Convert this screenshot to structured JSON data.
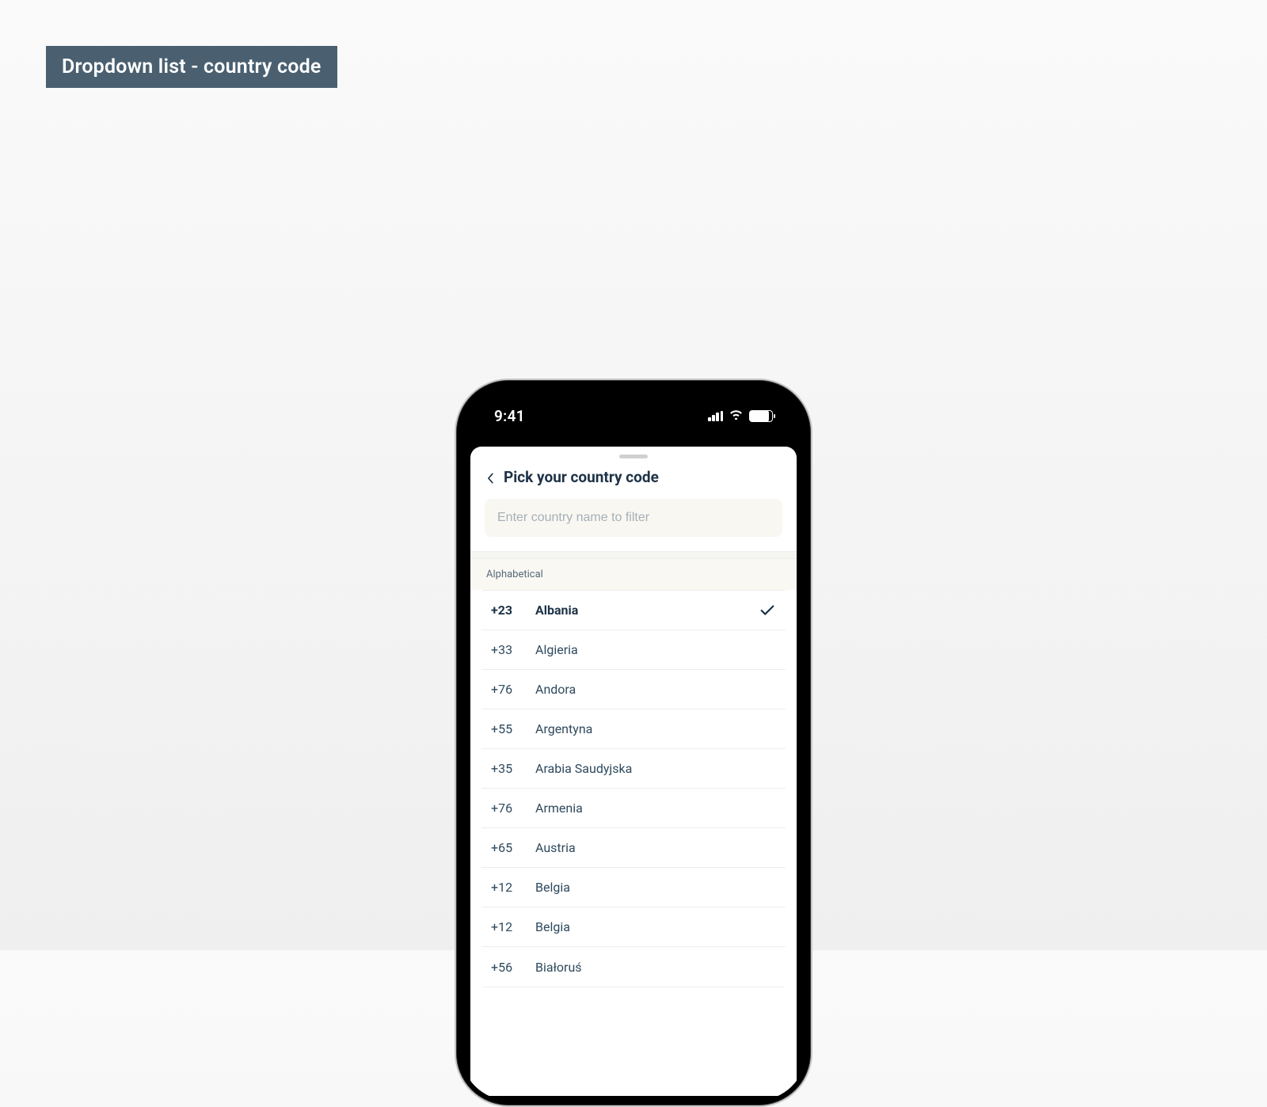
{
  "page": {
    "title_label": "Dropdown list - country code"
  },
  "status": {
    "time": "9:41"
  },
  "sheet": {
    "title": "Pick your country code",
    "search_placeholder": "Enter country name to filter",
    "section_label": "Alphabetical"
  },
  "countries": [
    {
      "code": "+23",
      "name": "Albania",
      "selected": true
    },
    {
      "code": "+33",
      "name": "Algieria",
      "selected": false
    },
    {
      "code": "+76",
      "name": "Andora",
      "selected": false
    },
    {
      "code": "+55",
      "name": "Argentyna",
      "selected": false
    },
    {
      "code": "+35",
      "name": "Arabia Saudyjska",
      "selected": false
    },
    {
      "code": "+76",
      "name": "Armenia",
      "selected": false
    },
    {
      "code": "+65",
      "name": "Austria",
      "selected": false
    },
    {
      "code": "+12",
      "name": "Belgia",
      "selected": false
    },
    {
      "code": "+12",
      "name": "Belgia",
      "selected": false
    },
    {
      "code": "+56",
      "name": "Białoruś",
      "selected": false
    }
  ]
}
